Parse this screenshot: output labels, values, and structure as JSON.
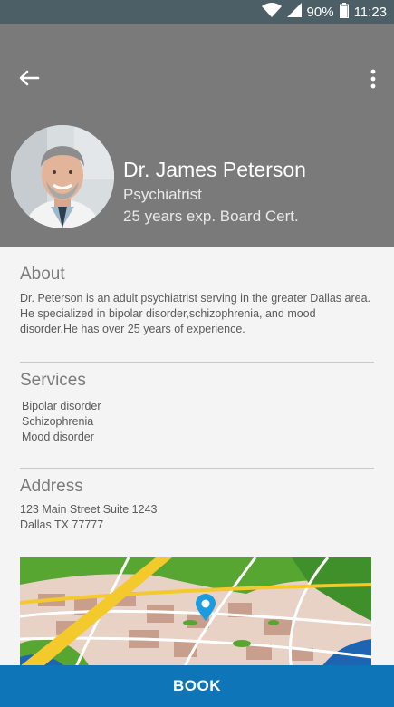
{
  "status_bar": {
    "battery": "90%",
    "time": "11:23",
    "icons": [
      "wifi-icon",
      "signal-icon",
      "battery-icon"
    ]
  },
  "header": {
    "back_icon": "arrow-left-icon",
    "menu_icon": "more-vert-icon",
    "name": "Dr. James Peterson",
    "specialty": "Psychiatrist",
    "experience": "25 years exp. Board Cert."
  },
  "about": {
    "heading": "About",
    "text": "Dr. Peterson is an adult psychiatrist serving in the greater Dallas area. He specialized in bipolar disorder,schizophrenia, and mood disorder.He has over 25 years of experience."
  },
  "services": {
    "heading": "Services",
    "items": [
      "Bipolar disorder",
      "Schizophrenia",
      "Mood disorder"
    ]
  },
  "address": {
    "heading": "Address",
    "line1": "123 Main Street Suite 1243",
    "line2": "Dallas TX 77777"
  },
  "map": {
    "pin_icon": "map-pin-icon"
  },
  "book_button": {
    "label": "BOOK"
  },
  "colors": {
    "header": "#7a7a7a",
    "status_bar": "#4d5f66",
    "book_button": "#0d75b8"
  }
}
